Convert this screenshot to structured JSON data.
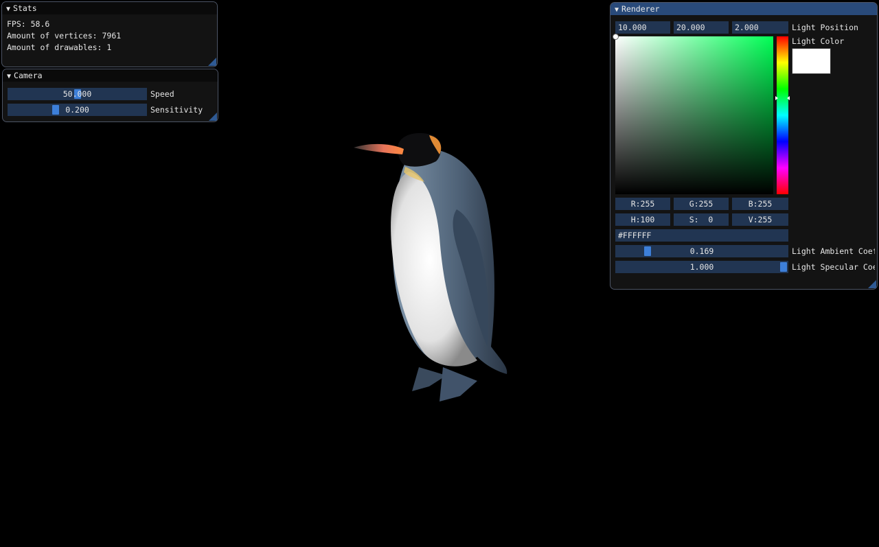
{
  "stats": {
    "title": "Stats",
    "fps_line": "FPS: 58.6",
    "vertices_line": "Amount of vertices: 7961",
    "drawables_line": "Amount of drawables: 1"
  },
  "camera": {
    "title": "Camera",
    "speed": {
      "value": "50.000",
      "label": "Speed"
    },
    "sensitivity": {
      "value": "0.200",
      "label": "Sensitivity"
    }
  },
  "renderer": {
    "title": "Renderer",
    "light_position": {
      "x": "10.000",
      "y": "20.000",
      "z": "2.000",
      "label": "Light Position"
    },
    "light_color": {
      "label": "Light Color",
      "hex_color": "#ffffff",
      "r": "R:255",
      "g": "G:255",
      "b": "B:255",
      "h": "H:100",
      "s": "S:  0",
      "v": "V:255",
      "hex": "#FFFFFF"
    },
    "ambient": {
      "value": "0.169",
      "label": "Light Ambient Coef"
    },
    "specular": {
      "value": "1.000",
      "label": "Light Specular Coef"
    }
  },
  "scene": {
    "object_icon": "penguin-icon"
  }
}
